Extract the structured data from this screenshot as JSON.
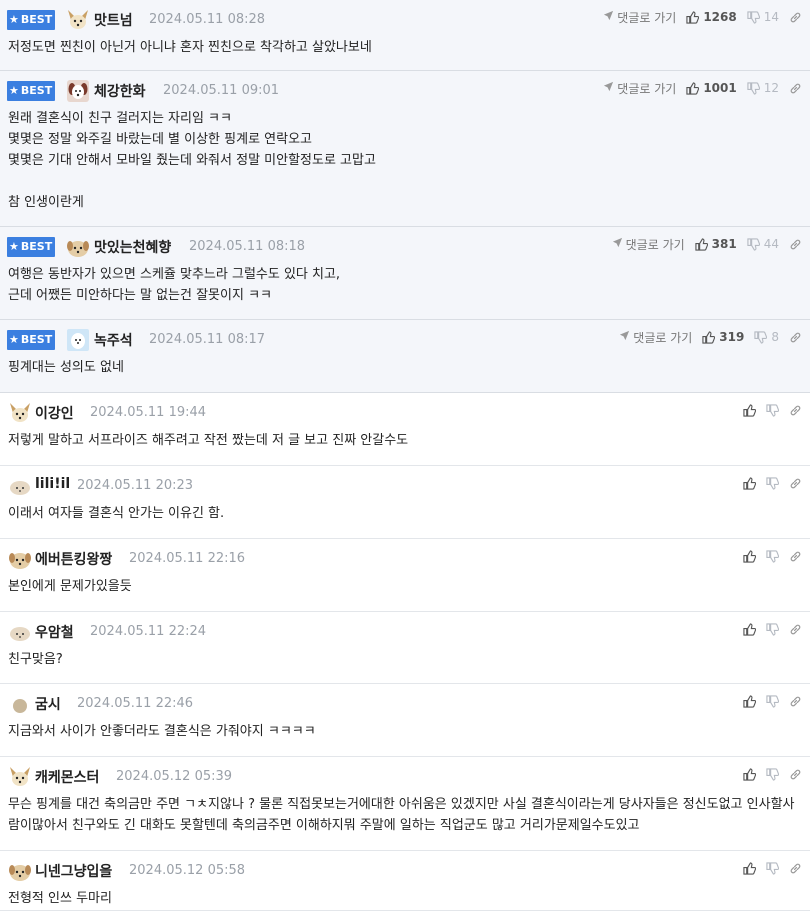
{
  "labels": {
    "best": "BEST",
    "goto": "댓글로 가기"
  },
  "colors": {
    "best_badge": "#3b7fe0",
    "best_bg": "#f4f6fa",
    "muted": "#9aa0a8"
  },
  "comments": [
    {
      "best": true,
      "avatar": "fox",
      "nick": "맛트넘",
      "time": "2024.05.11 08:28",
      "likes": "1268",
      "dislikes": "14",
      "text": "저정도면 찐친이 아닌거 아니냐 혼자 찐친으로 착각하고 살았나보네"
    },
    {
      "best": true,
      "avatar": "dog-brown",
      "nick": "체강한화",
      "time": "2024.05.11 09:01",
      "likes": "1001",
      "dislikes": "12",
      "text": "원래 결혼식이 친구 걸러지는 자리임 ㅋㅋ\n몇몇은 정말 와주길 바랐는데 별 이상한 핑계로 연락오고\n몇몇은 기대 안해서 모바일 줬는데 와줘서 정말 미안할정도로 고맙고\n\n참 인생이란게"
    },
    {
      "best": true,
      "avatar": "puppy",
      "nick": "맛있는천혜향",
      "time": "2024.05.11 08:18",
      "likes": "381",
      "dislikes": "44",
      "text": "여행은 동반자가 있으면 스케쥴 맞추느라 그럴수도 있다 치고,\n근데 어쨌든 미안하다는 말 없는건 잘못이지 ㅋㅋ"
    },
    {
      "best": true,
      "avatar": "blue",
      "nick": "녹주석",
      "time": "2024.05.11 08:17",
      "likes": "319",
      "dislikes": "8",
      "text": "핑계대는 성의도 없네"
    },
    {
      "best": false,
      "avatar": "fox",
      "nick": "이강인",
      "time": "2024.05.11 19:44",
      "text": "저렇게 말하고 서프라이즈 해주려고 작전 짰는데 저 글 보고 진짜 안갈수도"
    },
    {
      "best": false,
      "avatar": "sheep",
      "nick": "lili!il",
      "time": "2024.05.11 20:23",
      "text": "이래서 여자들 결혼식 안가는 이유긴 함."
    },
    {
      "best": false,
      "avatar": "puppy",
      "nick": "에버튼킹왕짱",
      "time": "2024.05.11 22:16",
      "text": "본인에게 문제가있을듯"
    },
    {
      "best": false,
      "avatar": "sheep",
      "nick": "우암철",
      "time": "2024.05.11 22:24",
      "text": "친구맞음?"
    },
    {
      "best": false,
      "avatar": "dot",
      "nick": "굼시",
      "time": "2024.05.11 22:46",
      "text": "지금와서 사이가 안좋더라도 결혼식은 가줘야지 ㅋㅋㅋㅋ"
    },
    {
      "best": false,
      "avatar": "fox",
      "nick": "캐케몬스터",
      "time": "2024.05.12 05:39",
      "text": "무슨 핑계를 대건 축의금만 주면 ㄱㅊ지않나 ? 물론 직접못보는거에대한 아쉬움은 있겠지만 사실 결혼식이라는게 당사자들은 정신도없고 인사할사람이많아서 친구와도 긴 대화도 못할텐데 축의금주면 이해하지뭐 주말에 일하는 직업군도 많고 거리가문제일수도있고"
    },
    {
      "best": false,
      "avatar": "puppy",
      "nick": "니넨그냥입을",
      "time": "2024.05.12 05:58",
      "text": "전형적 인쓰 두마리"
    }
  ]
}
